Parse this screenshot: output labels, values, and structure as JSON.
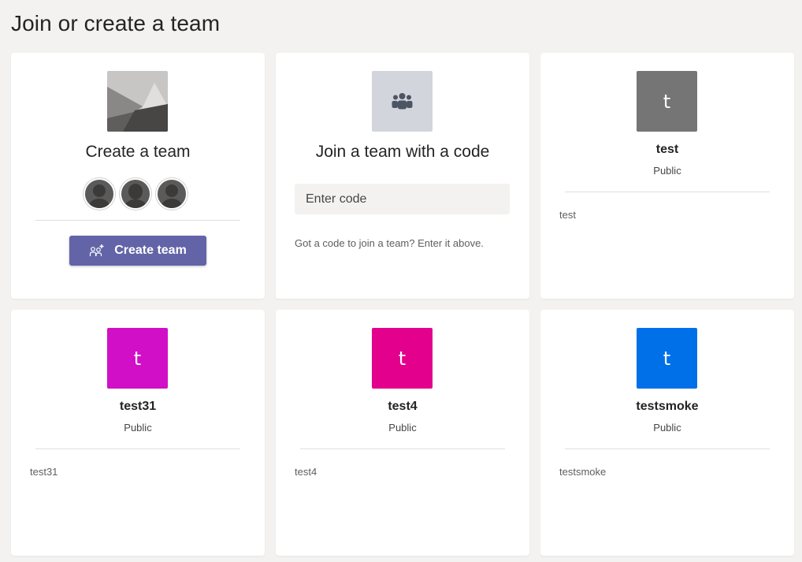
{
  "page": {
    "title": "Join or create a team"
  },
  "create_card": {
    "heading": "Create a team",
    "button_label": "Create team",
    "button_icon": "add-team-icon",
    "avatar_count": 3,
    "colors": {
      "button": "#6264a7"
    }
  },
  "join_card": {
    "heading": "Join a team with a code",
    "input_placeholder": "Enter code",
    "hint": "Got a code to join a team? Enter it above.",
    "icon": "teams-icon"
  },
  "teams": [
    {
      "letter": "t",
      "name": "test",
      "privacy": "Public",
      "description": "test",
      "color": "#757575"
    },
    {
      "letter": "t",
      "name": "test31",
      "privacy": "Public",
      "description": "test31",
      "color": "#d10fc7"
    },
    {
      "letter": "t",
      "name": "test4",
      "privacy": "Public",
      "description": "test4",
      "color": "#e3008c"
    },
    {
      "letter": "t",
      "name": "testsmoke",
      "privacy": "Public",
      "description": "testsmoke",
      "color": "#0070e8"
    }
  ]
}
